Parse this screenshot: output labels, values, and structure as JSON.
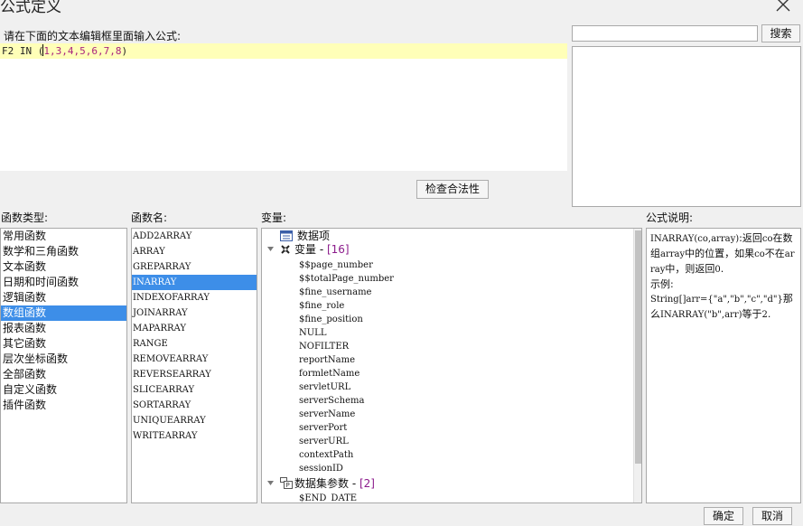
{
  "window": {
    "title": "公式定义"
  },
  "editor": {
    "label": "请在下面的文本编辑框里面输入公式:",
    "formula_prefix": "F2 IN (",
    "formula_args": "1,3,4,5,6,7,8",
    "formula_suffix": ")"
  },
  "search": {
    "value": "",
    "button_label": "搜索"
  },
  "check_button": "检查合法性",
  "function_types": {
    "label": "函数类型:",
    "items": [
      "常用函数",
      "数学和三角函数",
      "文本函数",
      "日期和时间函数",
      "逻辑函数",
      "数组函数",
      "报表函数",
      "其它函数",
      "层次坐标函数",
      "全部函数",
      "自定义函数",
      "插件函数"
    ],
    "selected": 5
  },
  "function_names": {
    "label": "函数名:",
    "items": [
      "ADD2ARRAY",
      "ARRAY",
      "GREPARRAY",
      "INARRAY",
      "INDEXOFARRAY",
      "JOINARRAY",
      "MAPARRAY",
      "RANGE",
      "REMOVEARRAY",
      "REVERSEARRAY",
      "SLICEARRAY",
      "SORTARRAY",
      "UNIQUEARRAY",
      "WRITEARRAY"
    ],
    "selected": 3
  },
  "variables": {
    "label": "变量:",
    "data_item": "数据项",
    "var_group": "变量",
    "var_group_sep": " - ",
    "var_count": "[16]",
    "vars": [
      "$$page_number",
      "$$totalPage_number",
      "$fine_username",
      "$fine_role",
      "$fine_position",
      "NULL",
      "NOFILTER",
      "reportName",
      "formletName",
      "servletURL",
      "serverSchema",
      "serverName",
      "serverPort",
      "serverURL",
      "contextPath",
      "sessionID"
    ],
    "dataset_group": "数据集参数",
    "dataset_sep": " - ",
    "dataset_count": "[2]",
    "dataset_params": [
      "$END_DATE"
    ]
  },
  "description": {
    "label": "公式说明:",
    "p1_mono": "INARRAY(co,array)",
    "p1_text_a": ":返回",
    "p1_mono2": "co",
    "p1_text_b": "在数组",
    "p1_mono3": "array",
    "p1_text_c": "中的位置，如果",
    "p1_mono4": "co",
    "p1_text_d": "不在",
    "p1_mono5": "array",
    "p1_text_e": "中，则返回",
    "p1_mono6": "0",
    "p1_text_f": ".",
    "example_label": "示例:",
    "ex_mono": "String[]arr={\"a\",\"b\",\"c\",\"d\"}",
    "ex_text": "那么",
    "ex_mono2": "INARRAY(\"b\",arr)",
    "ex_text2": "等于",
    "ex_mono3": "2",
    "ex_text3": "."
  },
  "footer": {
    "ok": "确定",
    "cancel": "取消"
  },
  "icons": {
    "close": "close-icon",
    "data_item": "table-icon",
    "var_group": "variable-icon",
    "dataset": "dataset-params-icon"
  }
}
